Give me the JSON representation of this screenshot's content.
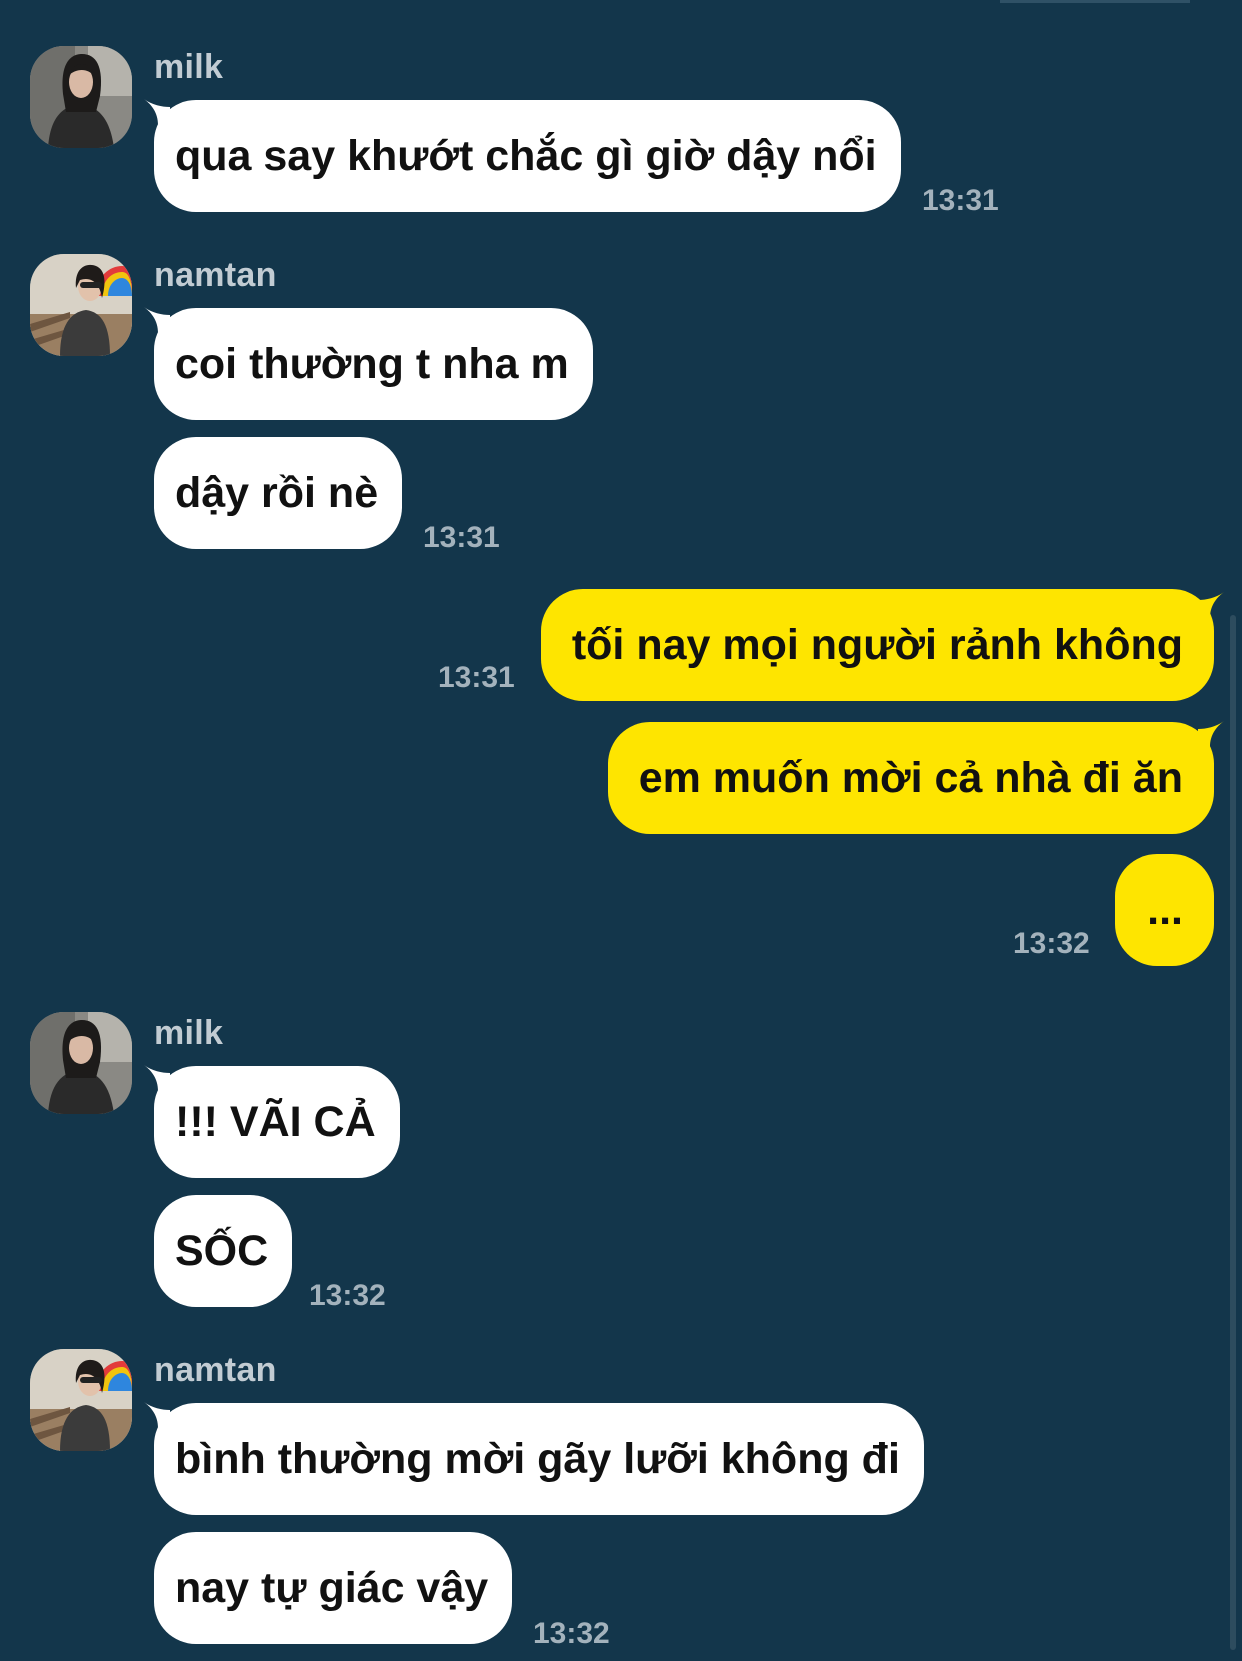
{
  "colors": {
    "background": "#13364b",
    "incoming_bubble": "#ffffff",
    "outgoing_bubble": "#fee500",
    "name_text": "#c2ccd3",
    "time_text": "#a3b2bc"
  },
  "messages": [
    {
      "sender": "milk",
      "avatar_icon": "profile-photo-milk",
      "texts": [
        "qua say khướt chắc gì giờ dậy nổi"
      ],
      "time": "13:31"
    },
    {
      "sender": "namtan",
      "avatar_icon": "profile-photo-namtan",
      "texts": [
        "coi thường t nha m",
        "dậy rồi nè"
      ],
      "time": "13:31"
    },
    {
      "sender": "me",
      "texts": [
        "tối nay mọi người rảnh không",
        "em muốn mời cả nhà đi ăn",
        "..."
      ],
      "times": [
        "13:31",
        "13:32"
      ]
    },
    {
      "sender": "milk",
      "avatar_icon": "profile-photo-milk",
      "texts": [
        "!!! VÃI CẢ",
        "SỐC"
      ],
      "time": "13:32"
    },
    {
      "sender": "namtan",
      "avatar_icon": "profile-photo-namtan",
      "texts": [
        "bình thường mời gãy lưỡi không đi",
        "nay tự giác vậy"
      ],
      "time": "13:32"
    }
  ]
}
